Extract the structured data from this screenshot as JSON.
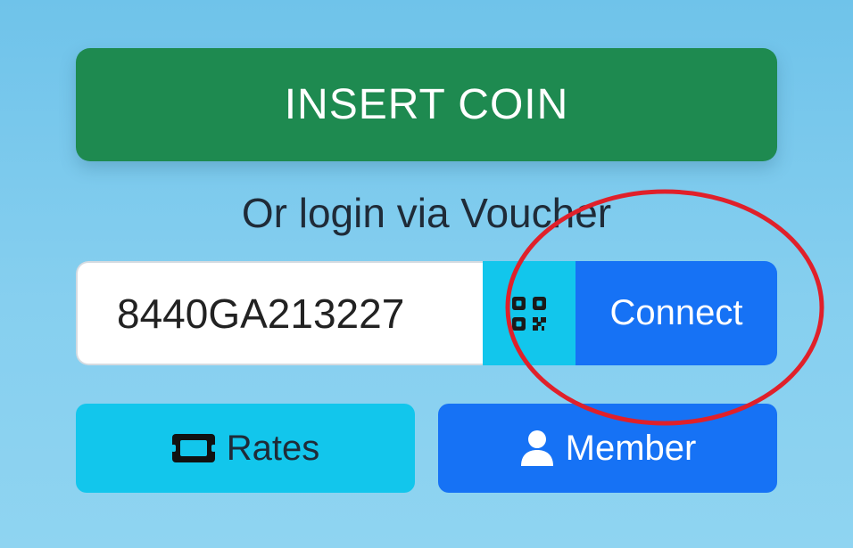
{
  "insert_coin": {
    "label": "INSERT COIN"
  },
  "voucher": {
    "caption": "Or login via Voucher",
    "code": "8440GA213227",
    "qr_icon": "qr-code-icon",
    "connect_label": "Connect"
  },
  "actions": {
    "rates_label": "Rates",
    "rates_icon": "ticket-icon",
    "member_label": "Member",
    "member_icon": "user-icon"
  },
  "colors": {
    "insert_coin_bg": "#1e8a50",
    "primary_blue": "#1672f5",
    "cyan": "#12c6ec",
    "annotation_red": "#e0202a"
  }
}
